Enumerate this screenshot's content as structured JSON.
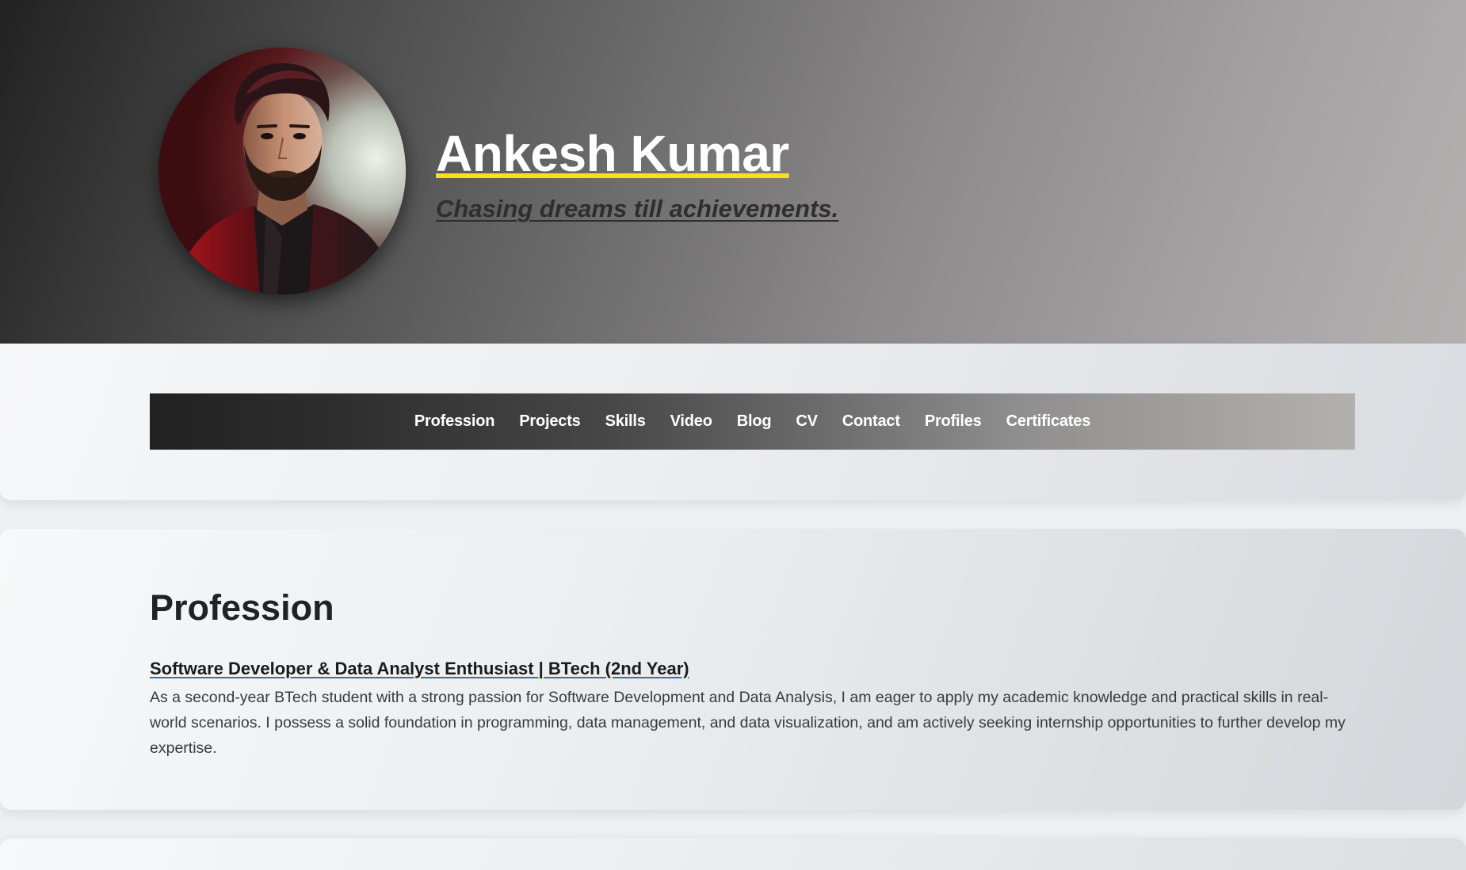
{
  "header": {
    "name": "Ankesh Kumar",
    "tagline": "Chasing dreams till achievements.",
    "underline_color": "#f7e11a"
  },
  "nav": {
    "items": [
      {
        "label": "Profession"
      },
      {
        "label": "Projects"
      },
      {
        "label": "Skills"
      },
      {
        "label": "Video"
      },
      {
        "label": "Blog"
      },
      {
        "label": "CV"
      },
      {
        "label": "Contact"
      },
      {
        "label": "Profiles"
      },
      {
        "label": "Certificates"
      }
    ]
  },
  "profession": {
    "heading": "Profession",
    "title": "Software Developer & Data Analyst Enthusiast | BTech (2nd Year)",
    "description": "As a second-year BTech student with a strong passion for Software Development and Data Analysis, I am eager to apply my academic knowledge and practical skills in real-world scenarios. I possess a solid foundation in programming, data management, and data visualization, and am actively seeking internship opportunities to further develop my expertise."
  }
}
